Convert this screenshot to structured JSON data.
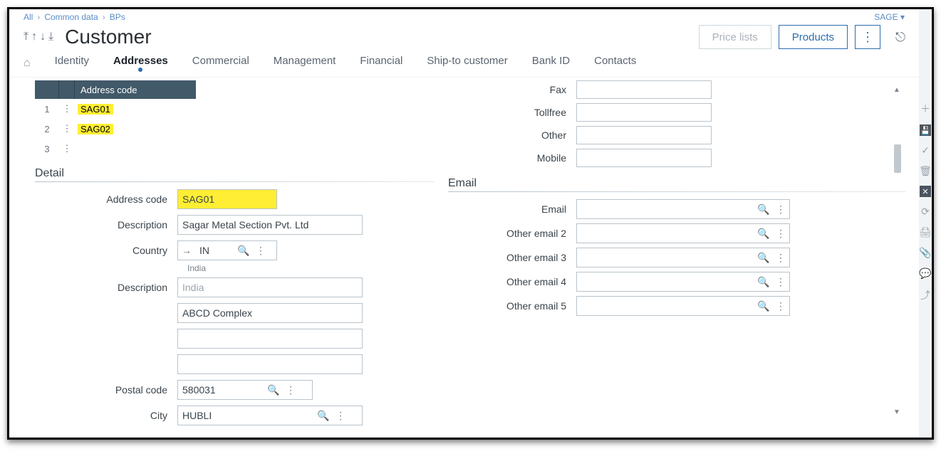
{
  "breadcrumb": [
    "All",
    "Common data",
    "BPs"
  ],
  "header": {
    "title": "Customer",
    "user": "SAGE",
    "buttons": {
      "price_lists": "Price lists",
      "products": "Products"
    }
  },
  "tabs": [
    "Identity",
    "Addresses",
    "Commercial",
    "Management",
    "Financial",
    "Ship-to customer",
    "Bank ID",
    "Contacts"
  ],
  "grid": {
    "header": "Address code",
    "rows": [
      {
        "n": "1",
        "code": "SAG01"
      },
      {
        "n": "2",
        "code": "SAG02"
      },
      {
        "n": "3",
        "code": ""
      }
    ]
  },
  "sections": {
    "detail": "Detail",
    "email": "Email"
  },
  "detail": {
    "labels": {
      "address_code": "Address code",
      "description": "Description",
      "country": "Country",
      "description2": "Description",
      "postal": "Postal code",
      "city": "City"
    },
    "values": {
      "address_code": "SAG01",
      "description": "Sagar Metal Section Pvt. Ltd",
      "country": "IN",
      "country_name": "India",
      "description2": "India",
      "addr1": "ABCD Complex",
      "postal": "580031",
      "city": "HUBLI"
    }
  },
  "contact": {
    "labels": {
      "fax": "Fax",
      "tollfree": "Tollfree",
      "other": "Other",
      "mobile": "Mobile"
    }
  },
  "email": {
    "labels": [
      "Email",
      "Other email 2",
      "Other email 3",
      "Other email 4",
      "Other email 5"
    ]
  }
}
